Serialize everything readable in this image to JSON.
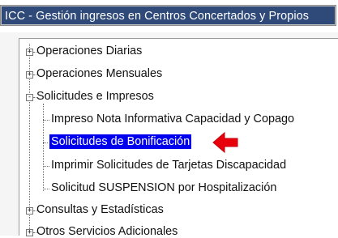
{
  "window": {
    "title": "ICC - Gestión ingresos en Centros Concertados y Propios"
  },
  "tree": {
    "items": [
      {
        "label": "Operaciones Diarias",
        "toggle": "+"
      },
      {
        "label": "Operaciones Mensuales",
        "toggle": "+"
      },
      {
        "label": "Solicitudes e Impresos",
        "toggle": "-"
      },
      {
        "label": "Impreso Nota Informativa Capacidad y Copago"
      },
      {
        "label": "Solicitudes de Bonificación"
      },
      {
        "label": "Imprimir Solicitudes de Tarjetas Discapacidad"
      },
      {
        "label": "Solicitud SUSPENSION por Hospitalización"
      },
      {
        "label": "Consultas y Estadísticas",
        "toggle": "+"
      },
      {
        "label": "Otros Servicios Adicionales",
        "toggle": "+"
      }
    ]
  },
  "colors": {
    "titlebar": "#2f4a79",
    "selection": "#0000ee",
    "arrow": "#e8000b"
  },
  "icons": {
    "pointer": "red-arrow-left-icon"
  }
}
